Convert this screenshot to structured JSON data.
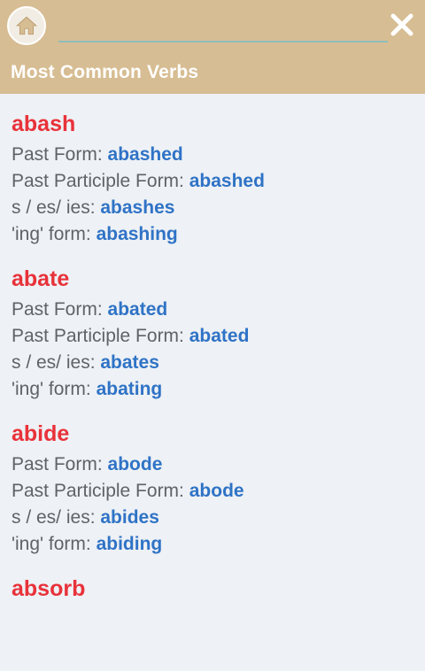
{
  "header": {
    "title": "Most Common Verbs",
    "search": {
      "value": "",
      "placeholder": ""
    },
    "home_icon": "home-icon",
    "close_icon": "close-icon",
    "colors": {
      "bar": "#d7bd93",
      "verb": "#e8323a",
      "value": "#2f73c6"
    }
  },
  "labels": {
    "past": "Past Form:",
    "past_participle": "Past Participle Form:",
    "s_form": "s / es/ ies:",
    "ing_form": "'ing' form:"
  },
  "verbs": [
    {
      "name": "abash",
      "past": "abashed",
      "past_participle": "abashed",
      "s_form": "abashes",
      "ing_form": "abashing"
    },
    {
      "name": "abate",
      "past": "abated",
      "past_participle": "abated",
      "s_form": "abates",
      "ing_form": "abating"
    },
    {
      "name": "abide",
      "past": "abode",
      "past_participle": "abode",
      "s_form": "abides",
      "ing_form": "abiding"
    },
    {
      "name": "absorb"
    }
  ]
}
